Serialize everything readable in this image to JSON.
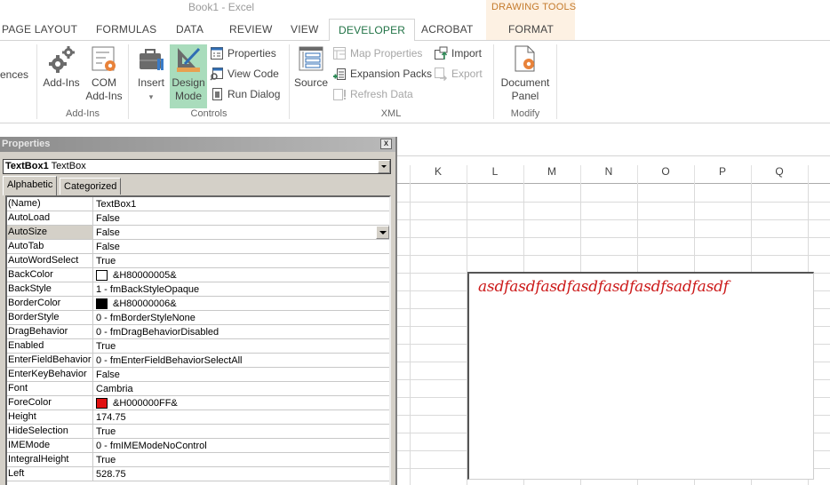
{
  "window": {
    "title": "Book1 - Excel"
  },
  "contextual_group": {
    "label": "DRAWING TOOLS"
  },
  "tabs": [
    {
      "label": "PAGE LAYOUT"
    },
    {
      "label": "FORMULAS"
    },
    {
      "label": "DATA"
    },
    {
      "label": "REVIEW"
    },
    {
      "label": "VIEW"
    },
    {
      "label": "DEVELOPER",
      "active": true
    },
    {
      "label": "ACROBAT"
    },
    {
      "label": "FORMAT"
    }
  ],
  "ribbon": {
    "partial_left_label": "ences",
    "groups": {
      "addins": {
        "label": "Add-Ins",
        "addins_button": "Add-Ins",
        "com_addins_line1": "COM",
        "com_addins_line2": "Add-Ins"
      },
      "controls": {
        "label": "Controls",
        "insert": "Insert",
        "design_mode_line1": "Design",
        "design_mode_line2": "Mode",
        "properties": "Properties",
        "view_code": "View Code",
        "run_dialog": "Run Dialog"
      },
      "xml": {
        "label": "XML",
        "source": "Source",
        "map_properties": "Map Properties",
        "expansion_packs": "Expansion Packs",
        "refresh_data": "Refresh Data",
        "import": "Import",
        "export": "Export"
      },
      "modify": {
        "label": "Modify",
        "document_panel_line1": "Document",
        "document_panel_line2": "Panel"
      }
    },
    "colors": {
      "accent_green": "#217346",
      "pressed_bg": "#a9dcbc",
      "gear_orange": "#e8823a"
    }
  },
  "properties_window": {
    "title": "Properties",
    "close_label": "x",
    "object_name": "TextBox1",
    "object_type": "TextBox",
    "tabs": [
      {
        "label": "Alphabetic",
        "active": true
      },
      {
        "label": "Categorized"
      }
    ],
    "rows": [
      {
        "name": "(Name)",
        "value": "TextBox1"
      },
      {
        "name": "AutoLoad",
        "value": "False"
      },
      {
        "name": "AutoSize",
        "value": "False",
        "selected": true
      },
      {
        "name": "AutoTab",
        "value": "False"
      },
      {
        "name": "AutoWordSelect",
        "value": "True"
      },
      {
        "name": "BackColor",
        "value": "&H80000005&",
        "swatch": "#ffffff"
      },
      {
        "name": "BackStyle",
        "value": "1 - fmBackStyleOpaque"
      },
      {
        "name": "BorderColor",
        "value": "&H80000006&",
        "swatch": "#000000"
      },
      {
        "name": "BorderStyle",
        "value": "0 - fmBorderStyleNone"
      },
      {
        "name": "DragBehavior",
        "value": "0 - fmDragBehaviorDisabled"
      },
      {
        "name": "Enabled",
        "value": "True"
      },
      {
        "name": "EnterFieldBehavior",
        "value": "0 - fmEnterFieldBehaviorSelectAll"
      },
      {
        "name": "EnterKeyBehavior",
        "value": "False"
      },
      {
        "name": "Font",
        "value": "Cambria"
      },
      {
        "name": "ForeColor",
        "value": "&H000000FF&",
        "swatch": "#e01010"
      },
      {
        "name": "Height",
        "value": "174.75"
      },
      {
        "name": "HideSelection",
        "value": "True"
      },
      {
        "name": "IMEMode",
        "value": "0 - fmIMEModeNoControl"
      },
      {
        "name": "IntegralHeight",
        "value": "True"
      },
      {
        "name": "Left",
        "value": "528.75"
      }
    ]
  },
  "sheet": {
    "columns": [
      "K",
      "L",
      "M",
      "N",
      "O",
      "P",
      "Q"
    ],
    "textbox": {
      "text": "asdfasdfasdfasdfasdfasdfsadfasdf",
      "color": "#cc1a1a"
    }
  }
}
